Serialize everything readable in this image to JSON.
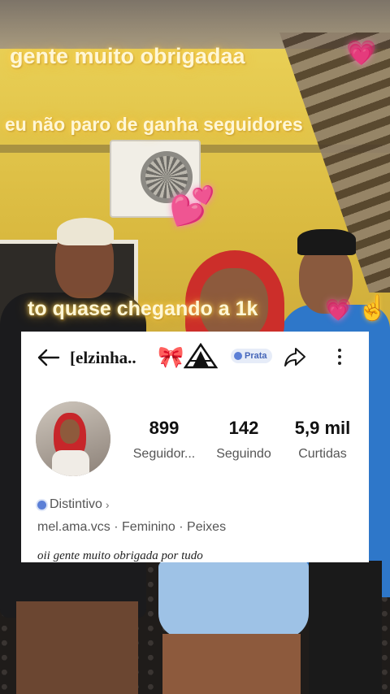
{
  "captions": {
    "line1": "gente  muito obrigadaa",
    "line2": "eu não paro de ganha seguidores",
    "line3": "to quase chegando a 1k"
  },
  "emojis": {
    "heart": "💗",
    "big_heart": "💕",
    "pointing_up": "☝"
  },
  "profile": {
    "username": "[elzinha..",
    "bow": "🎀",
    "badge": "Prata",
    "stats": [
      {
        "value": "899",
        "label": "Seguidor..."
      },
      {
        "value": "142",
        "label": "Seguindo"
      },
      {
        "value": "5,9 mil",
        "label": "Curtidas"
      }
    ],
    "distintivo": "Distintivo",
    "meta": "mel.ama.vcs · Feminino · Peixes",
    "bio": "oii gente muito obrigada por tudo"
  },
  "colors": {
    "caption_glow": "#ffd25a",
    "heart_pink": "#ff5aa8",
    "badge_blue": "#5b7fd6"
  }
}
